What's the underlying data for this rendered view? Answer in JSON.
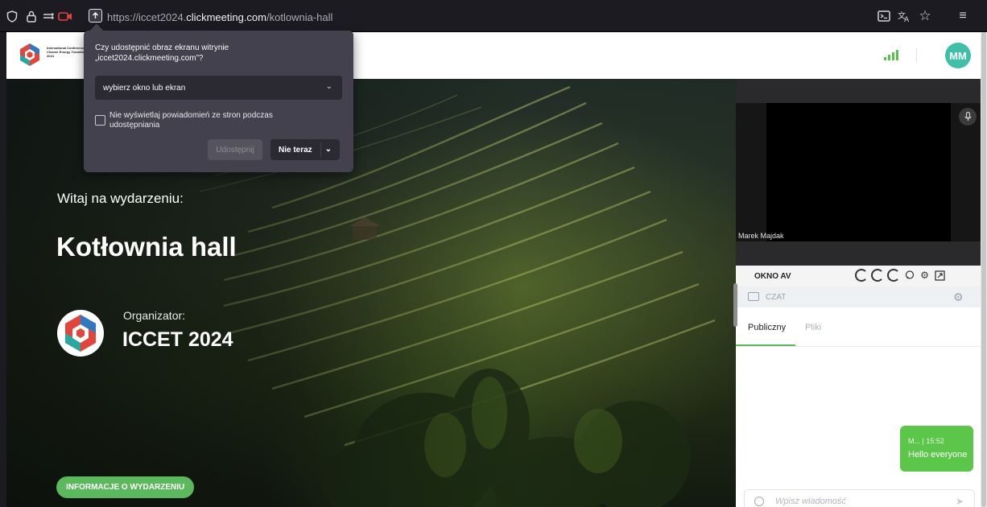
{
  "browser": {
    "url_scheme": "https://",
    "url_host_sub": "iccet2024.",
    "url_host": "clickmeeting.com",
    "url_path": "/kotlownia-hall"
  },
  "header": {
    "logo_text": "International Conference Cleaner Energy Transition 2024",
    "user_initials": "MM",
    "accent_color": "#3fbfa7"
  },
  "hero": {
    "welcome": "Witaj na wydarzeniu:",
    "title": "Kotłownia hall",
    "organizer_label": "Organizator:",
    "organizer_name": "ICCET 2024",
    "info_button": "INFORMACJE O WYDARZENIU"
  },
  "video": {
    "participant_name": "Marek Majdak",
    "panel_label": "OKNO AV"
  },
  "chat": {
    "header": "CZAT",
    "tabs": [
      {
        "label": "Publiczny"
      },
      {
        "label": "Pliki"
      }
    ],
    "messages": [
      {
        "meta": "M... | 15:52",
        "text": "Hello everyone"
      }
    ],
    "compose_placeholder": "Wpisz wiadomość"
  },
  "share_dialog": {
    "title": "Czy udostępnić obraz ekranu witrynie „iccet2024.clickmeeting.com”?",
    "select_value": "wybierz okno lub ekran",
    "checkbox_label": "Nie wyświetlaj powiadomień ze stron podczas udostępniania",
    "share_button": "Udostępnij",
    "not_now_button": "Nie teraz"
  },
  "colors": {
    "green": "#5cb85c",
    "chat_bubble": "#5cc64a",
    "dialog_bg": "#42414d"
  }
}
